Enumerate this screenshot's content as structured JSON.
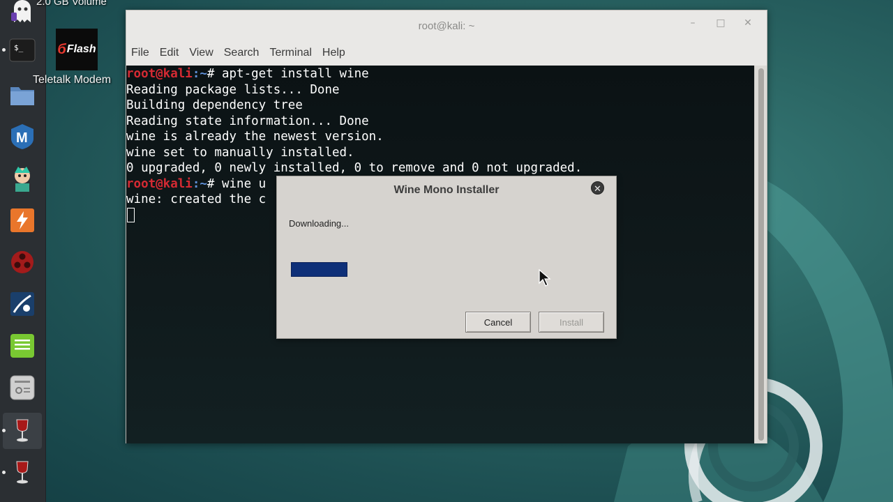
{
  "desktop": {
    "top_label": "2.0 GB Volume",
    "icons": [
      {
        "name": "teletalk-modem",
        "label": "Teletalk Modem",
        "logo_text": "Flash"
      }
    ]
  },
  "dock": {
    "items": [
      "ghost",
      "terminal",
      "files",
      "metasploit",
      "armitage",
      "burpsuite",
      "faraday",
      "cherrytree",
      "leafpad",
      "settings",
      "wine",
      "wine"
    ]
  },
  "terminal": {
    "title": "root@kali: ~",
    "menu": [
      "File",
      "Edit",
      "View",
      "Search",
      "Terminal",
      "Help"
    ],
    "lines": [
      {
        "user": "root@kali",
        "path": ":~",
        "cmd": "# apt-get install wine"
      },
      {
        "text": "Reading package lists... Done"
      },
      {
        "text": "Building dependency tree"
      },
      {
        "text": "Reading state information... Done"
      },
      {
        "text": "wine is already the newest version."
      },
      {
        "text": "wine set to manually installed."
      },
      {
        "text": "0 upgraded, 0 newly installed, 0 to remove and 0 not upgraded."
      },
      {
        "user": "root@kali",
        "path": ":~",
        "cmd": "# wine u"
      },
      {
        "text": "wine: created the c"
      }
    ]
  },
  "dialog": {
    "title": "Wine Mono Installer",
    "status": "Downloading...",
    "progress": 0.42,
    "cancel_label": "Cancel",
    "install_label": "Install"
  },
  "colors": {
    "prompt_user": "#d52a33",
    "prompt_path": "#5f8fd6",
    "progress_fill": "#0e2f78"
  }
}
